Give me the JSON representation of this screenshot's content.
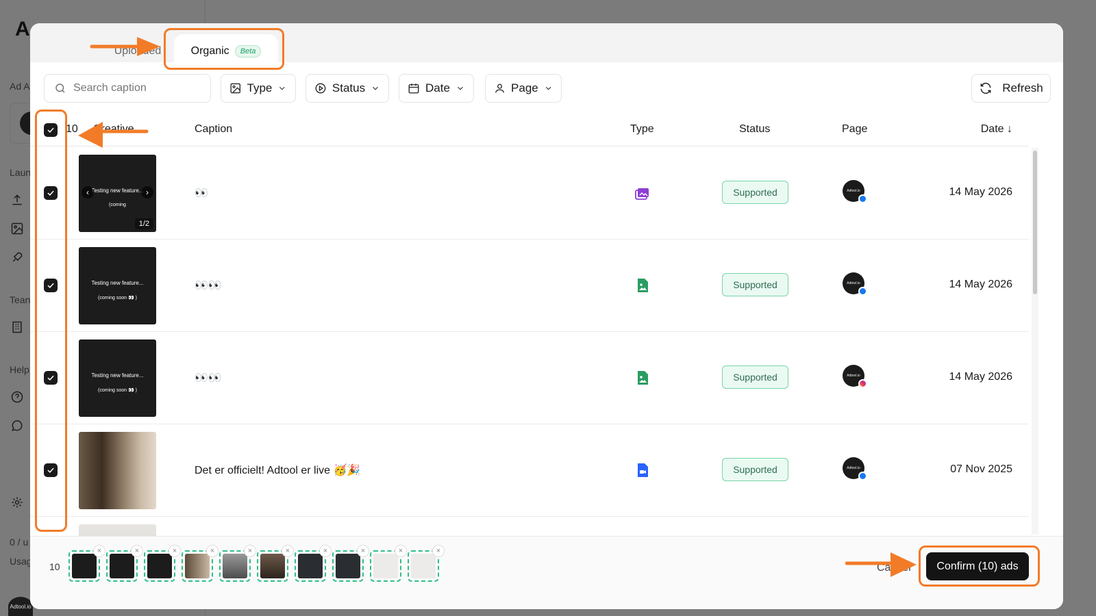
{
  "background": {
    "logo": "A",
    "section_ad": "Ad A",
    "section_launch": "Laun",
    "section_team": "Tean",
    "section_help": "Help",
    "usage_count": "0 / u",
    "usage_label": "Usag",
    "avatar_label": "Adtool.io"
  },
  "tabs": {
    "uploaded": "Uploaded",
    "organic": "Organic",
    "organic_badge": "Beta"
  },
  "toolbar": {
    "search_placeholder": "Search caption",
    "filter_type": "Type",
    "filter_status": "Status",
    "filter_date": "Date",
    "filter_page": "Page",
    "refresh": "Refresh"
  },
  "table": {
    "selected_count": "10",
    "headers": {
      "creative": "Creative",
      "caption": "Caption",
      "type": "Type",
      "status": "Status",
      "page": "Page",
      "date": "Date ↓"
    },
    "rows": [
      {
        "thumb_line1": "Testing new feature...",
        "thumb_line2": "(coming",
        "thumb_counter": "1/2",
        "caption": "👀",
        "type_icon": "carousel-icon",
        "status": "Supported",
        "page_label": "Adtool.io",
        "platform": "facebook",
        "date": "14 May 2026"
      },
      {
        "thumb_line1": "Testing new feature...",
        "thumb_line2": "(coming soon 👀 )",
        "caption": "👀👀",
        "type_icon": "image-file-icon",
        "status": "Supported",
        "page_label": "Adtool.io",
        "platform": "facebook",
        "date": "14 May 2026"
      },
      {
        "thumb_line1": "Testing new feature...",
        "thumb_line2": "(coming soon 👀 )",
        "caption": "👀👀",
        "type_icon": "image-file-icon",
        "status": "Supported",
        "page_label": "Adtool.io",
        "platform": "instagram",
        "date": "14 May 2026"
      },
      {
        "thumb_line1": "",
        "thumb_line2": "",
        "caption": "Det er officielt! Adtool er live 🥳🎉",
        "type_icon": "video-file-icon",
        "status": "Supported",
        "page_label": "Adtool.io",
        "platform": "facebook",
        "date": "07 Nov 2025"
      }
    ]
  },
  "footer": {
    "selected_count": "10",
    "cancel": "Cancel",
    "confirm": "Confirm (10) ads",
    "remove_glyph": "×"
  },
  "colors": {
    "accent_annotation": "#f27b28",
    "status_border": "#79d4a8",
    "status_text": "#2f6d52",
    "confirm_bg": "#141414",
    "type_carousel": "#8e3ed6",
    "type_image": "#2a9d62",
    "type_video": "#2962ff"
  }
}
